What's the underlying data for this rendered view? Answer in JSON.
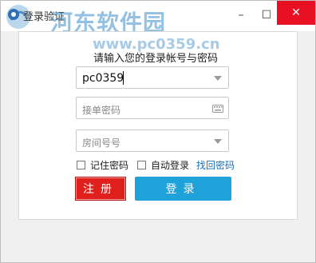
{
  "window": {
    "title": "登录验证",
    "minimize_label": "–",
    "maximize_label": "☐",
    "close_label": "✕"
  },
  "watermark": {
    "site_name": "河东软件园",
    "url": "www.pc0359.cn"
  },
  "form": {
    "prompt": "请输入您的登录帐号与密码",
    "account_value": "pc0359",
    "password_placeholder": "接单密码",
    "room_placeholder": "房间号号",
    "remember_password_label": "记住密码",
    "auto_login_label": "自动登录",
    "find_password_link": "找回密码",
    "register_button": "注册",
    "login_button": "登录"
  },
  "colors": {
    "close_button": "#e81123",
    "register_button": "#e0201d",
    "login_button": "#1fa1d9",
    "link": "#1b6fb5"
  }
}
